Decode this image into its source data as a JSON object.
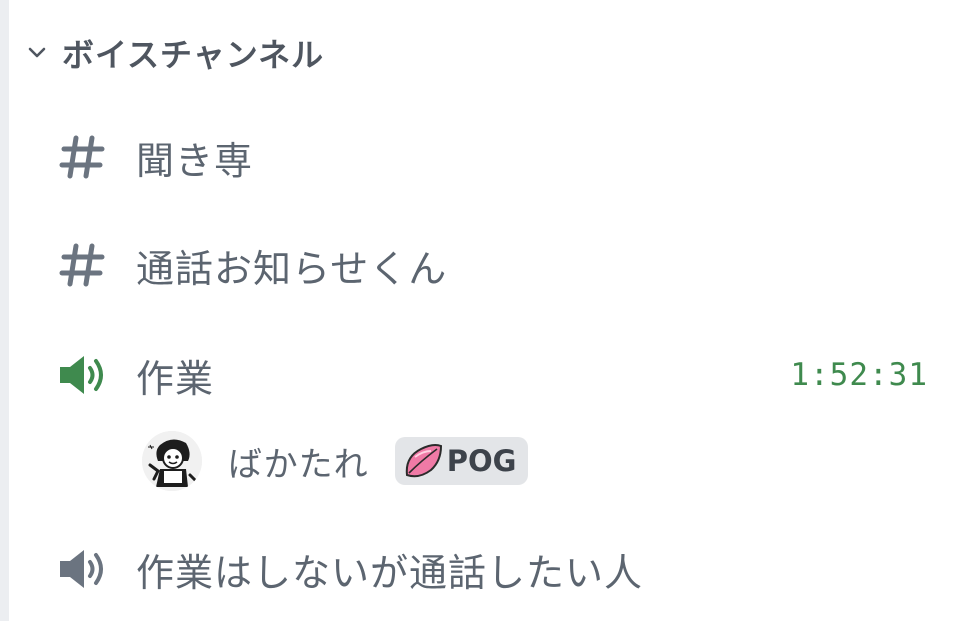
{
  "category": {
    "title": "ボイスチャンネル",
    "icon": "chevron-down-icon"
  },
  "channels": [
    {
      "name": "聞き専",
      "icon": "hash-icon"
    },
    {
      "name": "通話お知らせくん",
      "icon": "hash-icon"
    },
    {
      "name": "作業",
      "icon": "speaker-icon",
      "timer": "1:52:31",
      "active": true
    },
    {
      "name": "作業はしないが通話したい人",
      "icon": "speaker-icon"
    }
  ],
  "voice_user": {
    "name": "ばかたれ",
    "badge": "POG",
    "badge_icon": "pink-leaf-icon",
    "avatar": "avatar"
  },
  "colors": {
    "active_speaker": "#3f8a4e",
    "timer": "#3f8a4e",
    "icon_gray": "#6b7480",
    "text": "#5c6570",
    "badge_bg": "#e3e5e8",
    "sidebar_edge": "#eceef1"
  }
}
